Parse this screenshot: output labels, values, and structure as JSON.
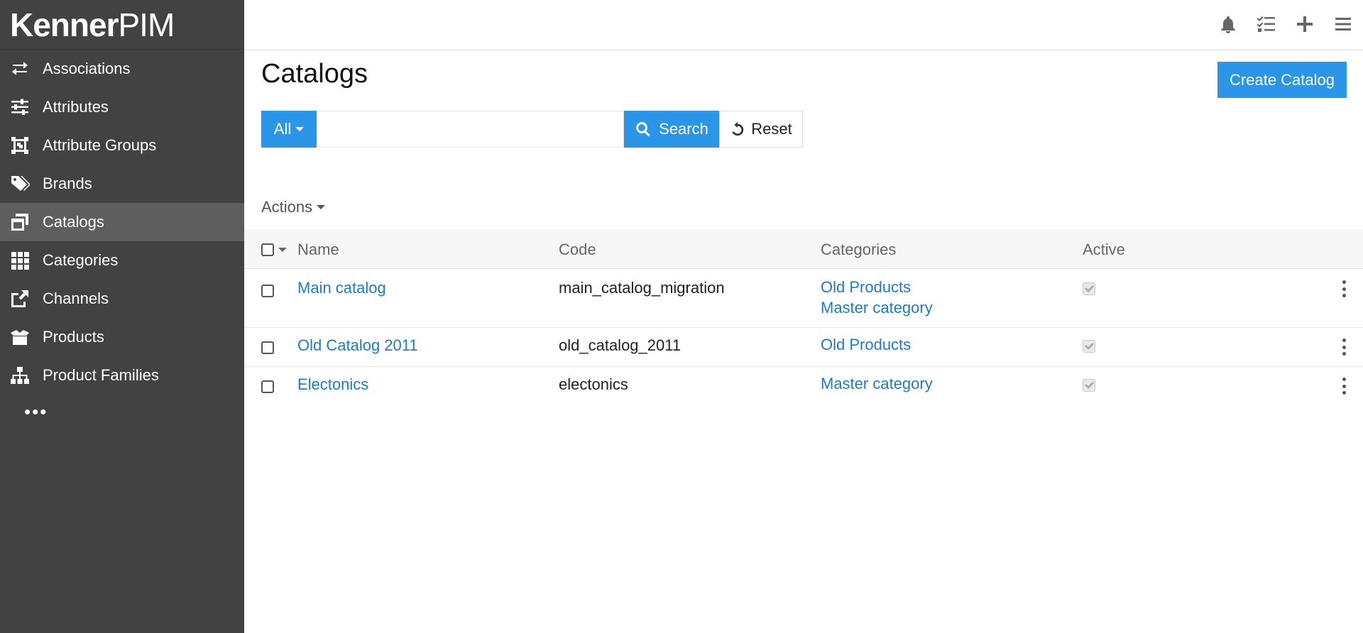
{
  "app": {
    "logo_bold": "Kenner",
    "logo_light": "PIM"
  },
  "sidebar": {
    "items": [
      {
        "label": "Associations",
        "icon": "arrows-exchange-icon"
      },
      {
        "label": "Attributes",
        "icon": "sliders-icon"
      },
      {
        "label": "Attribute Groups",
        "icon": "object-group-icon"
      },
      {
        "label": "Brands",
        "icon": "tags-icon"
      },
      {
        "label": "Catalogs",
        "icon": "window-restore-icon",
        "active": true
      },
      {
        "label": "Categories",
        "icon": "grid-icon"
      },
      {
        "label": "Channels",
        "icon": "share-square-icon"
      },
      {
        "label": "Products",
        "icon": "box-open-icon"
      },
      {
        "label": "Product Families",
        "icon": "sitemap-icon"
      }
    ],
    "more": "•••"
  },
  "topbar": {
    "icons": [
      "bell-icon",
      "tasks-icon",
      "plus-icon",
      "hamburger-menu-icon"
    ]
  },
  "page": {
    "title": "Catalogs",
    "create_label": "Create Catalog"
  },
  "search": {
    "scope_label": "All",
    "value": "",
    "placeholder": "",
    "search_label": "Search",
    "reset_label": "Reset"
  },
  "actions_label": "Actions",
  "grid": {
    "headers": {
      "name": "Name",
      "code": "Code",
      "categories": "Categories",
      "active": "Active"
    },
    "rows": [
      {
        "name": "Main catalog",
        "code": "main_catalog_migration",
        "categories": [
          "Old Products",
          "Master category"
        ],
        "active": true
      },
      {
        "name": "Old Catalog 2011",
        "code": "old_catalog_2011",
        "categories": [
          "Old Products"
        ],
        "active": true
      },
      {
        "name": "Electonics",
        "code": "electonics",
        "categories": [
          "Master category"
        ],
        "active": true
      }
    ]
  },
  "colors": {
    "sidebar_bg": "#424242",
    "sidebar_active": "#5e5e5e",
    "primary": "#2b95e8",
    "link": "#1c7cc7"
  }
}
